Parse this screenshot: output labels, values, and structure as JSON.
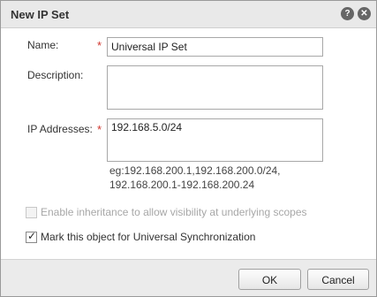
{
  "dialog": {
    "title": "New IP Set",
    "help_glyph": "?",
    "close_glyph": "✕"
  },
  "form": {
    "name_label": "Name:",
    "name_value": "Universal IP Set",
    "description_label": "Description:",
    "description_value": "",
    "ip_label": "IP Addresses:",
    "ip_value": "192.168.5.0/24",
    "ip_hint_line1": "eg:192.168.200.1,192.168.200.0/24,",
    "ip_hint_line2": "192.168.200.1-192.168.200.24",
    "required_marker": "*"
  },
  "options": {
    "inheritance_label": "Enable inheritance to allow visibility at underlying scopes",
    "inheritance_checked": false,
    "inheritance_enabled": false,
    "universal_label": "Mark this object for Universal Synchronization",
    "universal_checked": true,
    "check_glyph": "✓"
  },
  "footer": {
    "ok_label": "OK",
    "cancel_label": "Cancel"
  }
}
